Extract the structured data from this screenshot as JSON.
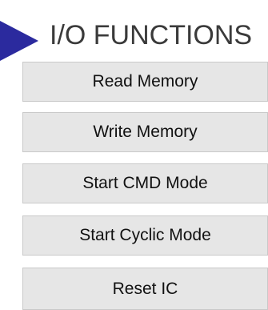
{
  "header": {
    "title": "I/O FUNCTIONS",
    "icon": "triangle-right-icon",
    "accent_color": "#2b2a9e"
  },
  "buttons": [
    {
      "label": "Read Memory"
    },
    {
      "label": "Write Memory"
    },
    {
      "label": "Start CMD Mode"
    },
    {
      "label": "Start Cyclic Mode"
    },
    {
      "label": "Reset IC"
    }
  ]
}
